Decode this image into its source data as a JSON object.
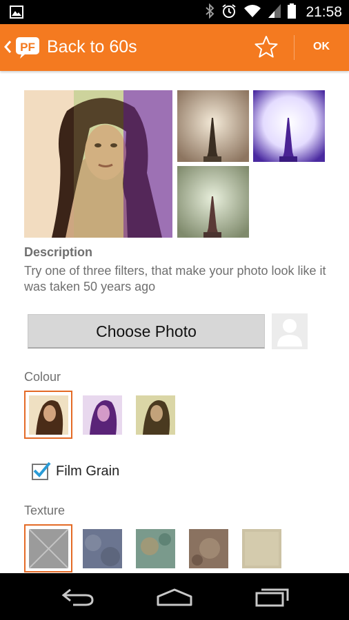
{
  "status_bar": {
    "time": "21:58",
    "icons": [
      "image-icon",
      "bluetooth-icon",
      "alarm-icon",
      "wifi-icon",
      "signal-icon",
      "battery-icon"
    ]
  },
  "action_bar": {
    "title": "Back to 60s",
    "ok_label": "OK",
    "logo_text": "PF",
    "accent": "#f47a20"
  },
  "description": {
    "heading": "Description",
    "text": "Try one of three filters, that make your photo look like it was taken 50 years ago"
  },
  "choose_photo_label": "Choose Photo",
  "colour": {
    "label": "Colour",
    "options": [
      "warm",
      "purple",
      "green"
    ],
    "selected": 0
  },
  "film_grain": {
    "label": "Film Grain",
    "checked": true
  },
  "texture": {
    "label": "Texture",
    "selected": 0
  }
}
